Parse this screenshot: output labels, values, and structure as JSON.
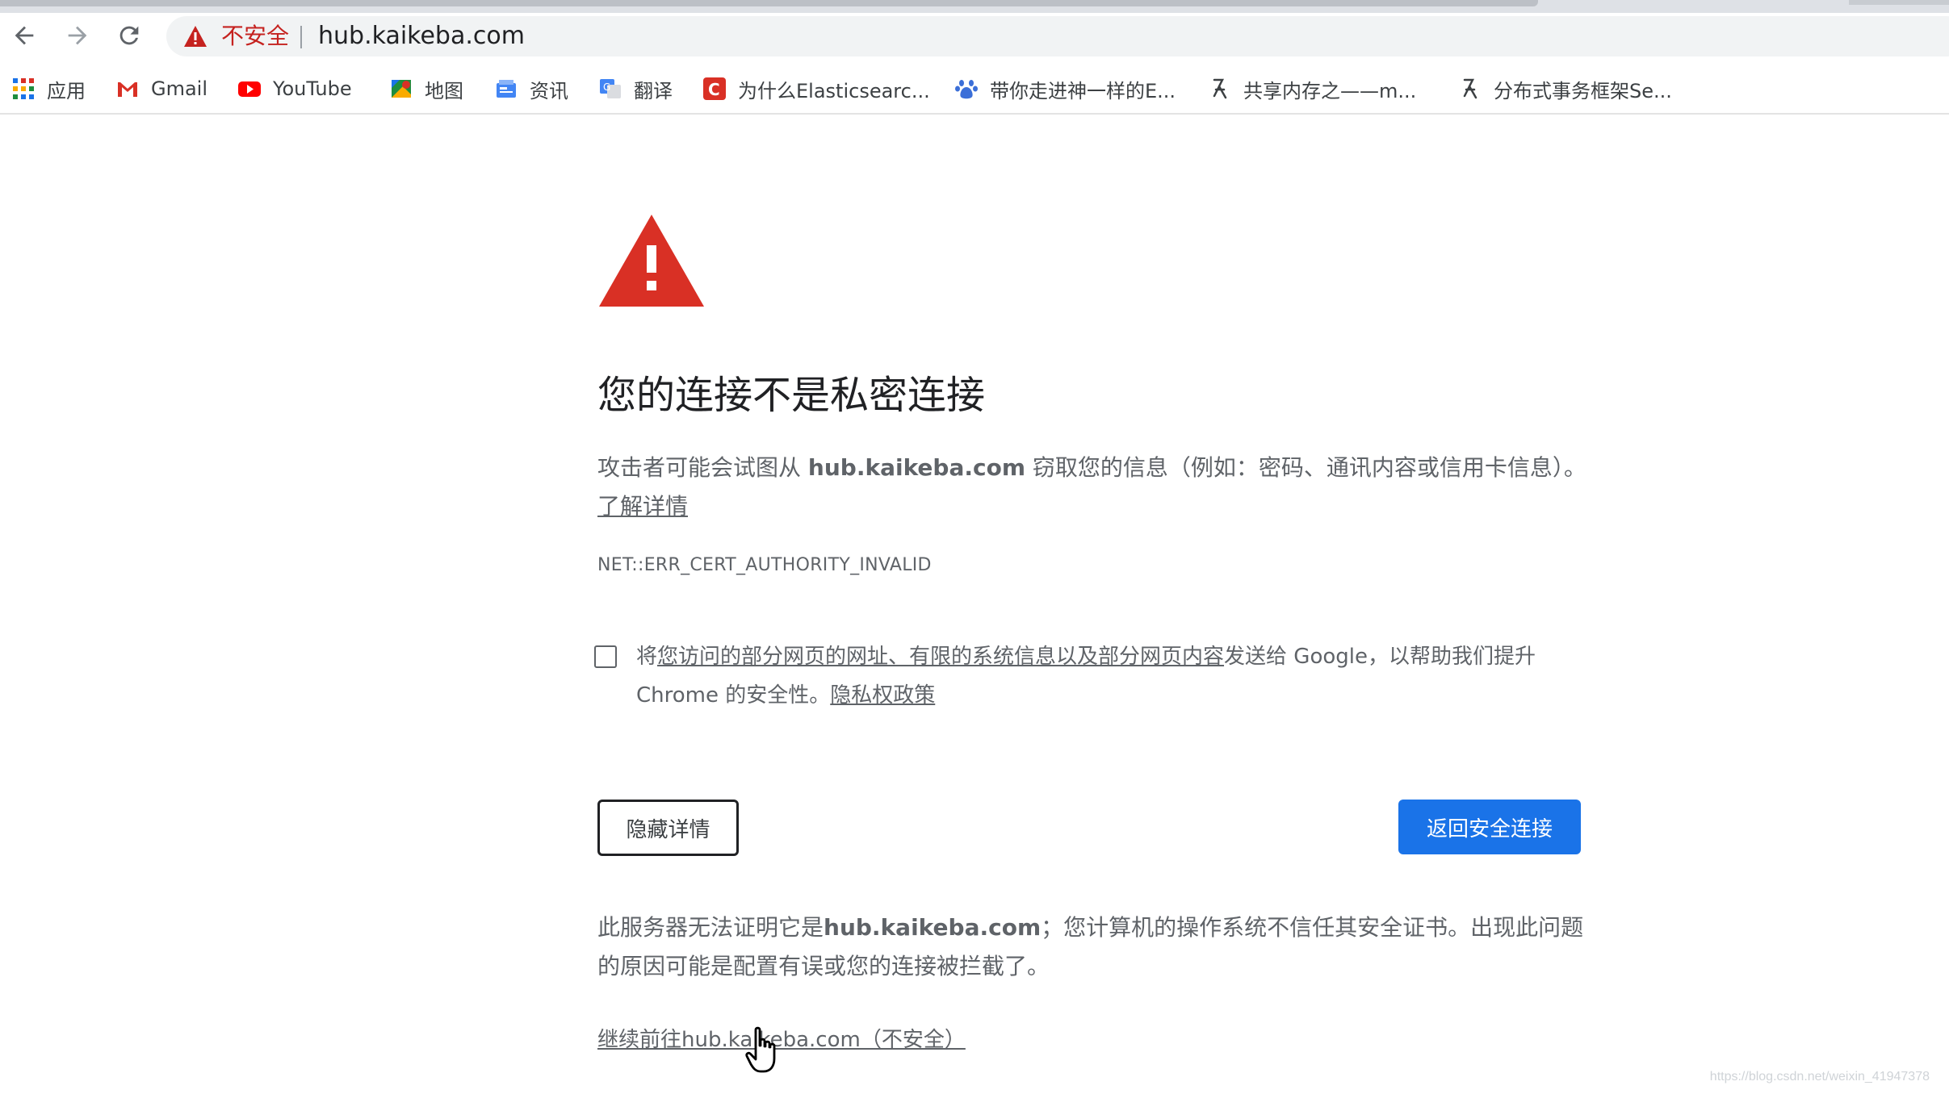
{
  "browser": {
    "url": "hub.kaikeba.com",
    "security_label": "不安全"
  },
  "bookmarks": [
    {
      "label": "应用",
      "icon": "apps-grid-icon"
    },
    {
      "label": "Gmail",
      "icon": "gmail-icon"
    },
    {
      "label": "YouTube",
      "icon": "youtube-icon"
    },
    {
      "label": "地图",
      "icon": "maps-icon"
    },
    {
      "label": "资讯",
      "icon": "news-icon"
    },
    {
      "label": "翻译",
      "icon": "translate-icon"
    },
    {
      "label": "为什么Elasticsearc...",
      "icon": "csdn-icon"
    },
    {
      "label": "带你走进神一样的E...",
      "icon": "paw-icon"
    },
    {
      "label": "共享内存之——m...",
      "icon": "bookmark-figure-icon"
    },
    {
      "label": "分布式事务框架Se...",
      "icon": "bookmark-figure-icon"
    }
  ],
  "interstitial": {
    "title": "您的连接不是私密连接",
    "desc_prefix": "攻击者可能会试图从 ",
    "desc_host": "hub.kaikeba.com",
    "desc_suffix": " 窃取您的信息（例如：密码、通讯内容或信用卡信息）。",
    "learn_more": "了解详情",
    "error_code": "NET::ERR_CERT_AUTHORITY_INVALID",
    "checkbox_prefix": "将",
    "checkbox_link": "您访问的部分网页的网址、有限的系统信息以及部分网页内容",
    "checkbox_suffix": "发送给 Google，以帮助我们提升 Chrome 的安全性。",
    "privacy_link": "隐私权政策",
    "hide_details_label": "隐藏详情",
    "back_to_safety_label": "返回安全连接",
    "detail_prefix": "此服务器无法证明它是",
    "detail_host": "hub.kaikeba.com",
    "detail_suffix": "；您计算机的操作系统不信任其安全证书。出现此问题的原因可能是配置有误或您的连接被拦截了。",
    "proceed_link": "继续前往hub.kaikeba.com（不安全）"
  },
  "watermark": "https://blog.csdn.net/weixin_41947378",
  "colors": {
    "warning_red": "#d93025",
    "primary_blue": "#1a73e8",
    "text_secondary": "#5f6368"
  }
}
